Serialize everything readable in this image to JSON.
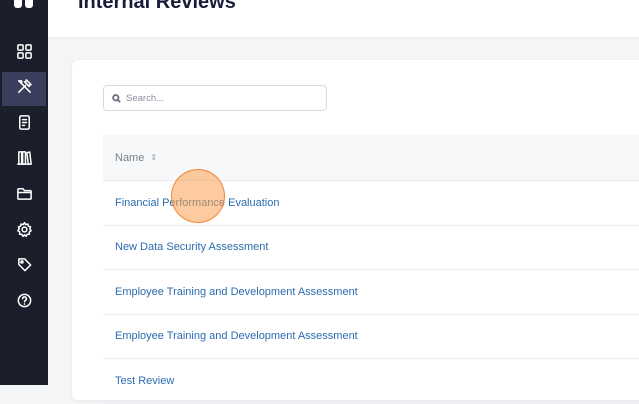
{
  "page": {
    "title": "Internal Reviews"
  },
  "sidebar": {
    "items": [
      {
        "icon": "grid-icon",
        "active": false
      },
      {
        "icon": "tools-icon",
        "active": true
      },
      {
        "icon": "document-icon",
        "active": false
      },
      {
        "icon": "library-icon",
        "active": false
      },
      {
        "icon": "folder-icon",
        "active": false
      },
      {
        "icon": "gear-icon",
        "active": false
      },
      {
        "icon": "tag-icon",
        "active": false
      },
      {
        "icon": "help-icon",
        "active": false
      }
    ]
  },
  "search": {
    "placeholder": "Search...",
    "value": ""
  },
  "table": {
    "columns": [
      {
        "label": "Name",
        "sort_icon": "⇕"
      }
    ],
    "rows": [
      {
        "name": "Financial Performance Evaluation"
      },
      {
        "name": "New Data Security Assessment"
      },
      {
        "name": "Employee Training and Development Assessment"
      },
      {
        "name": "Employee Training and Development Assessment"
      },
      {
        "name": "Test Review"
      }
    ]
  },
  "colors": {
    "sidebar": "#1b1e2b",
    "active": "#3a3f5c",
    "link": "#2b6cb0",
    "cursor": "#fba050"
  }
}
